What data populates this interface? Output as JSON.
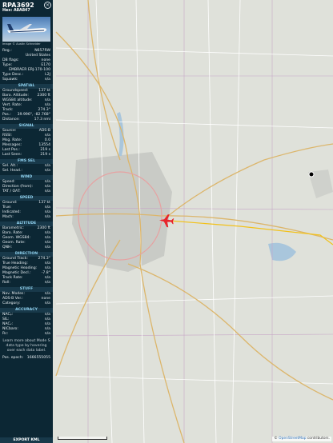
{
  "aircraft": {
    "callsign": "RPA3692",
    "hex_label": "Hex: A8A847",
    "photo_credit": "Image © Austin Schneider"
  },
  "info": [
    {
      "k": "Reg.:",
      "v": "N657RW"
    },
    {
      "k": "",
      "v": "United States"
    },
    {
      "k": "DB flags:",
      "v": "none"
    },
    {
      "k": "Type:",
      "v": "E170"
    },
    {
      "k": "",
      "v": "EMBRAER ERJ-170-100"
    },
    {
      "k": "Type Desc.:",
      "v": "L2J"
    },
    {
      "k": "Squawk:",
      "v": "n/a"
    }
  ],
  "sections": [
    {
      "title": "SPATIAL",
      "rows": [
        {
          "k": "Groundspeed:",
          "v": "137 kt"
        },
        {
          "k": "Baro. Altitude:",
          "v": "2300 ft"
        },
        {
          "k": "WGS84 altitude:",
          "v": "n/a"
        },
        {
          "k": "Vert. Rate:",
          "v": "n/a"
        },
        {
          "k": "Track:",
          "v": "274.3°"
        },
        {
          "k": "Pos.:",
          "v": "39.996°, -82.768°"
        },
        {
          "k": "Distance:",
          "v": "17.3 nmi"
        }
      ]
    },
    {
      "title": "SIGNAL",
      "rows": [
        {
          "k": "Source:",
          "v": "ADS-B"
        },
        {
          "k": "RSSI:",
          "v": "n/a"
        },
        {
          "k": "Msg. Rate:",
          "v": "0.0"
        },
        {
          "k": "Messages:",
          "v": "13554"
        },
        {
          "k": "Last Pos.:",
          "v": "219 s"
        },
        {
          "k": "Last Seen:",
          "v": "219 s"
        }
      ]
    },
    {
      "title": "FMS SEL",
      "rows": [
        {
          "k": "Sel. Alt.:",
          "v": "n/a"
        },
        {
          "k": "Sel. Head.:",
          "v": "n/a"
        }
      ]
    },
    {
      "title": "WIND",
      "rows": [
        {
          "k": "Speed:",
          "v": "n/a"
        },
        {
          "k": "Direction (from):",
          "v": "n/a"
        },
        {
          "k": "TAT / OAT:",
          "v": "n/a"
        }
      ]
    },
    {
      "title": "SPEED",
      "rows": [
        {
          "k": "Ground:",
          "v": "137 kt"
        },
        {
          "k": "True:",
          "v": "n/a"
        },
        {
          "k": "Indicated:",
          "v": "n/a"
        },
        {
          "k": "Mach:",
          "v": "n/a"
        }
      ]
    },
    {
      "title": "ALTITUDE",
      "rows": [
        {
          "k": "Barometric:",
          "v": "2300 ft"
        },
        {
          "k": "Baro. Rate:",
          "v": "n/a"
        },
        {
          "k": "Geom. WGS84:",
          "v": "n/a"
        },
        {
          "k": "Geom. Rate:",
          "v": "n/a"
        },
        {
          "k": "QNH:",
          "v": "n/a"
        }
      ]
    },
    {
      "title": "DIRECTION",
      "rows": [
        {
          "k": "Ground Track:",
          "v": "274.3°"
        },
        {
          "k": "True Heading:",
          "v": "n/a"
        },
        {
          "k": "Magnetic Heading:",
          "v": "n/a"
        },
        {
          "k": "Magnetic Decl.:",
          "v": "-7.8°"
        },
        {
          "k": "Track Rate:",
          "v": "n/a"
        },
        {
          "k": "Roll:",
          "v": "n/a"
        }
      ]
    },
    {
      "title": "STUFF",
      "rows": [
        {
          "k": "Nav. Modes:",
          "v": "n/a"
        },
        {
          "k": "ADS-B Ver.:",
          "v": "none"
        },
        {
          "k": "Category:",
          "v": "n/a"
        }
      ]
    },
    {
      "title": "ACCURACY",
      "rows": [
        {
          "k": "NACₚ:",
          "v": "n/a"
        },
        {
          "k": "SIL:",
          "v": "n/a"
        },
        {
          "k": "NACᵥ:",
          "v": "n/a"
        },
        {
          "k": "NICbaro:",
          "v": "n/a"
        },
        {
          "k": "Rc:",
          "v": "n/a"
        }
      ]
    }
  ],
  "note": "Learn more about Mode S data type by hovering over each data label.",
  "pos_epoch": {
    "k": "Pos. epoch:",
    "v": "1666555055"
  },
  "export_label": "EXPORT KML",
  "attribution": {
    "prefix": "© ",
    "link": "OpenStreetMap",
    "suffix": " contributors."
  },
  "colors": {
    "panel_bg": "#0c2734",
    "section_bg": "#18394a",
    "section_text": "#8fd1ee",
    "aircraft": "#e8242b",
    "track": "#f2c11a"
  },
  "icons": {
    "close": "close-icon",
    "aircraft": "airplane-icon"
  }
}
